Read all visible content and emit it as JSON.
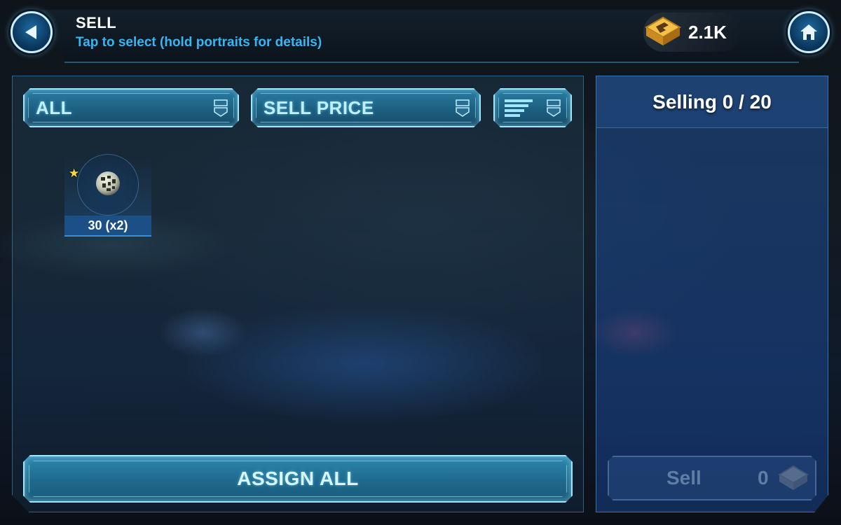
{
  "header": {
    "title": "SELL",
    "subtitle": "Tap to select (hold portraits for details)",
    "currency": {
      "amount": "2.1K",
      "icon": "credits-icon"
    },
    "back_icon": "back-arrow-icon",
    "home_icon": "home-icon"
  },
  "filters": {
    "category": {
      "selected": "ALL"
    },
    "sort": {
      "selected": "SELL PRICE"
    },
    "order": {
      "icon": "sort-order-icon"
    }
  },
  "items": [
    {
      "icon": "gear-sphere-icon",
      "price_label": "30 (x2)",
      "starred": true
    }
  ],
  "selling_panel": {
    "header": "Selling 0 / 20",
    "sell_button": {
      "label": "Sell",
      "amount": "0",
      "enabled": false
    }
  },
  "assign_button": {
    "label": "ASSIGN ALL"
  },
  "colors": {
    "accent": "#9fe6ff",
    "subtitle": "#39b5f0",
    "button_fill": "#1e6a8d",
    "panel_fill": "#1f5096",
    "star": "#ffd83a"
  }
}
